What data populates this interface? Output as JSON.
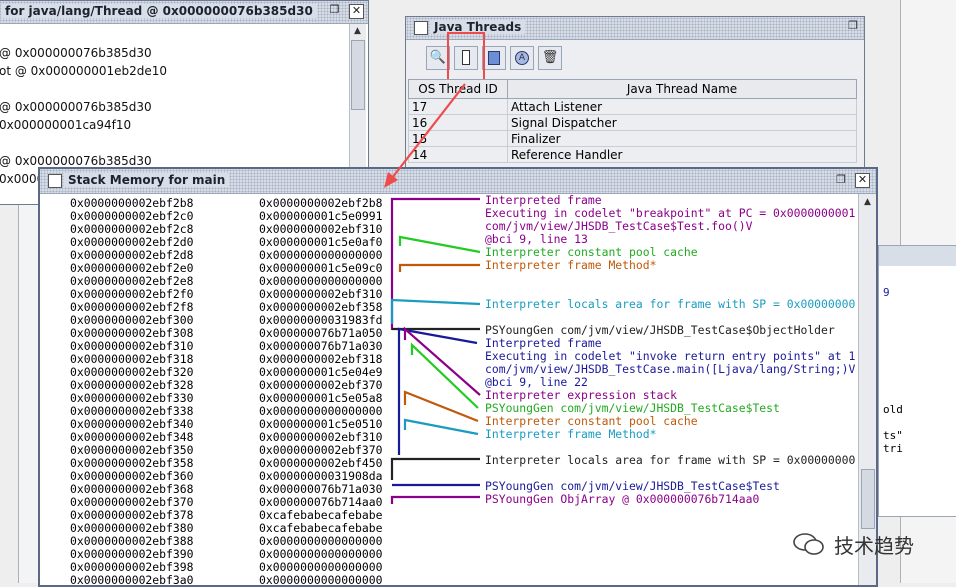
{
  "left_window": {
    "title": "for java/lang/Thread @ 0x000000076b385d30",
    "lines": [
      "@ 0x000000076b385d30",
      "ot @ 0x000000001eb2de10",
      "",
      "@ 0x000000076b385d30",
      "0x000000001ca94f10",
      "",
      "@ 0x000000076b385d30",
      "0x000000"
    ]
  },
  "threads_window": {
    "title": "Java Threads",
    "toolbar_icons": [
      "inspect-icon",
      "stack-memory-icon",
      "stack-trace-icon",
      "thread-info-icon",
      "trash-icon"
    ],
    "columns": [
      "OS Thread ID",
      "Java Thread Name"
    ],
    "rows": [
      {
        "id": "17",
        "name": "Attach Listener"
      },
      {
        "id": "16",
        "name": "Signal Dispatcher"
      },
      {
        "id": "15",
        "name": "Finalizer"
      },
      {
        "id": "14",
        "name": "Reference Handler"
      }
    ]
  },
  "stack_window": {
    "title": "Stack Memory for main",
    "addresses": [
      "0x0000000002ebf2b8",
      "0x0000000002ebf2c0",
      "0x0000000002ebf2c8",
      "0x0000000002ebf2d0",
      "0x0000000002ebf2d8",
      "0x0000000002ebf2e0",
      "0x0000000002ebf2e8",
      "0x0000000002ebf2f0",
      "0x0000000002ebf2f8",
      "0x0000000002ebf300",
      "0x0000000002ebf308",
      "0x0000000002ebf310",
      "0x0000000002ebf318",
      "0x0000000002ebf320",
      "0x0000000002ebf328",
      "0x0000000002ebf330",
      "0x0000000002ebf338",
      "0x0000000002ebf340",
      "0x0000000002ebf348",
      "0x0000000002ebf350",
      "0x0000000002ebf358",
      "0x0000000002ebf360",
      "0x0000000002ebf368",
      "0x0000000002ebf370",
      "0x0000000002ebf378",
      "0x0000000002ebf380",
      "0x0000000002ebf388",
      "0x0000000002ebf390",
      "0x0000000002ebf398",
      "0x0000000002ebf3a0"
    ],
    "values": [
      "0x0000000002ebf2b8",
      "0x000000001c5e0991",
      "0x0000000002ebf310",
      "0x000000001c5e0af0",
      "0x0000000000000000",
      "0x000000001c5e09c0",
      "0x0000000000000000",
      "0x0000000002ebf310",
      "0x0000000002ebf358",
      "0x00000000031983fd",
      "0x000000076b71a050",
      "0x000000076b71a030",
      "0x0000000002ebf318",
      "0x000000001c5e04e9",
      "0x0000000002ebf370",
      "0x000000001c5e05a8",
      "0x0000000000000000",
      "0x000000001c5e0510",
      "0x0000000002ebf310",
      "0x0000000002ebf370",
      "0x0000000002ebf450",
      "0x00000000031908da",
      "0x000000076b71a030",
      "0x000000076b714aa0",
      "0xcafebabecafebabe",
      "0xcafebabecafebabe",
      "0x0000000000000000",
      "0x0000000000000000",
      "0x0000000000000000",
      "0x0000000000000000"
    ],
    "annotations": [
      {
        "text": "Interpreted frame",
        "color": "#8b008b"
      },
      {
        "text": "Executing in codelet \"breakpoint\" at PC = 0x0000000001",
        "color": "#8b008b"
      },
      {
        "text": "com/jvm/view/JHSDB_TestCase$Test.foo()V",
        "color": "#8b008b"
      },
      {
        "text": "@bci 9, line 13",
        "color": "#8b008b"
      },
      {
        "text": "Interpreter constant pool cache",
        "color": "#22aa22"
      },
      {
        "text": "Interpreter frame Method*",
        "color": "#c0590a"
      },
      {
        "text": "",
        "color": "#000"
      },
      {
        "text": "",
        "color": "#000"
      },
      {
        "text": "Interpreter locals area for frame with SP = 0x00000000",
        "color": "#1a9cc0"
      },
      {
        "text": "",
        "color": "#000"
      },
      {
        "text": "PSYoungGen com/jvm/view/JHSDB_TestCase$ObjectHolder",
        "color": "#222222"
      },
      {
        "text": "Interpreted frame",
        "color": "#1a1a99"
      },
      {
        "text": "Executing in codelet \"invoke return entry points\" at 1",
        "color": "#1a1a99"
      },
      {
        "text": "com/jvm/view/JHSDB_TestCase.main([Ljava/lang/String;)V",
        "color": "#1a1a99"
      },
      {
        "text": "@bci 9, line 22",
        "color": "#1a1a99"
      },
      {
        "text": "Interpreter expression stack",
        "color": "#8b008b"
      },
      {
        "text": "PSYoungGen com/jvm/view/JHSDB_TestCase$Test",
        "color": "#22aa22"
      },
      {
        "text": "Interpreter constant pool cache",
        "color": "#c0590a"
      },
      {
        "text": "Interpreter frame Method*",
        "color": "#1a9cc0"
      },
      {
        "text": "",
        "color": "#000"
      },
      {
        "text": "Interpreter locals area for frame with SP = 0x00000000",
        "color": "#222222"
      },
      {
        "text": "",
        "color": "#000"
      },
      {
        "text": "PSYoungGen com/jvm/view/JHSDB_TestCase$Test",
        "color": "#1a1a99"
      },
      {
        "text": "PSYoungGen ObjArray @ 0x000000076b714aa0",
        "color": "#8b008b"
      }
    ]
  },
  "right_partial": {
    "lines": [
      "9",
      "old",
      "ts\"",
      "tri"
    ]
  },
  "watermark": "技术趋势"
}
